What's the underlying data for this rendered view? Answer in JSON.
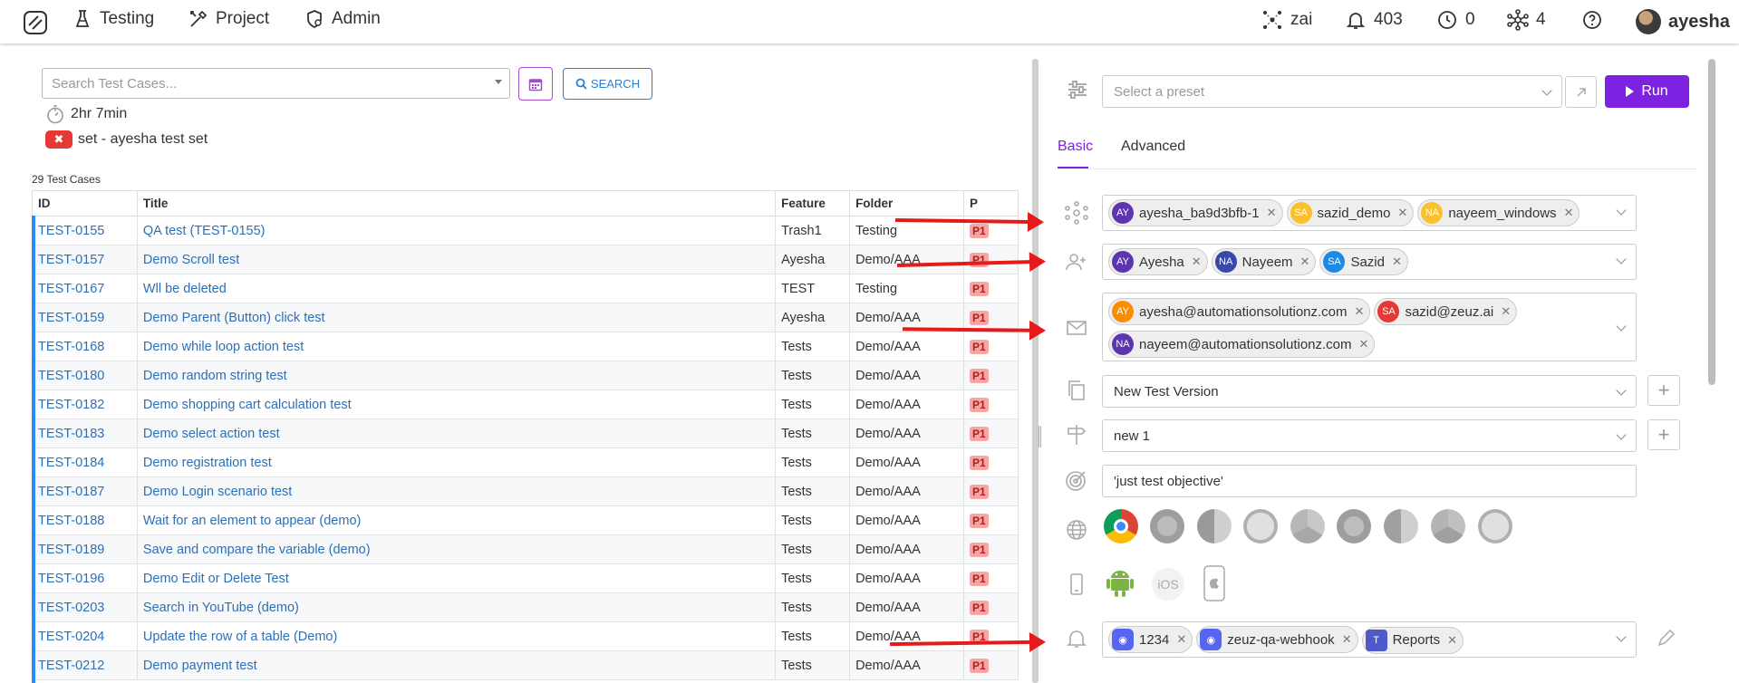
{
  "nav": {
    "items": [
      {
        "label": "Testing",
        "icon": "flask-icon"
      },
      {
        "label": "Project",
        "icon": "tools-icon"
      },
      {
        "label": "Admin",
        "icon": "admin-gear-icon"
      }
    ],
    "right": {
      "zai_label": "zai",
      "notifications": "403",
      "clock_count": "0",
      "nodes_count": "4",
      "help_icon": "help-icon",
      "username": "ayesha"
    }
  },
  "left": {
    "search_placeholder": "Search Test Cases...",
    "search_label": "SEARCH",
    "duration": "2hr 7min",
    "set_label": "set - ayesha test set",
    "count_label": "29 Test Cases",
    "columns": [
      "ID",
      "Title",
      "Feature",
      "Folder",
      "P"
    ],
    "rows": [
      {
        "id": "TEST-0155",
        "title": "QA test (TEST-0155)",
        "feature": "Trash1",
        "folder": "Testing",
        "p": "P1"
      },
      {
        "id": "TEST-0157",
        "title": "Demo Scroll test",
        "feature": "Ayesha",
        "folder": "Demo/AAA",
        "p": "P1"
      },
      {
        "id": "TEST-0167",
        "title": "Wll be deleted",
        "feature": "TEST",
        "folder": "Testing",
        "p": "P1"
      },
      {
        "id": "TEST-0159",
        "title": "Demo Parent (Button) click test",
        "feature": "Ayesha",
        "folder": "Demo/AAA",
        "p": "P1"
      },
      {
        "id": "TEST-0168",
        "title": "Demo while loop action test",
        "feature": "Tests",
        "folder": "Demo/AAA",
        "p": "P1"
      },
      {
        "id": "TEST-0180",
        "title": "Demo random string test",
        "feature": "Tests",
        "folder": "Demo/AAA",
        "p": "P1"
      },
      {
        "id": "TEST-0182",
        "title": "Demo shopping cart calculation test",
        "feature": "Tests",
        "folder": "Demo/AAA",
        "p": "P1"
      },
      {
        "id": "TEST-0183",
        "title": "Demo select action test",
        "feature": "Tests",
        "folder": "Demo/AAA",
        "p": "P1"
      },
      {
        "id": "TEST-0184",
        "title": "Demo registration test",
        "feature": "Tests",
        "folder": "Demo/AAA",
        "p": "P1"
      },
      {
        "id": "TEST-0187",
        "title": "Demo Login scenario test",
        "feature": "Tests",
        "folder": "Demo/AAA",
        "p": "P1"
      },
      {
        "id": "TEST-0188",
        "title": "Wait for an element to appear (demo)",
        "feature": "Tests",
        "folder": "Demo/AAA",
        "p": "P1"
      },
      {
        "id": "TEST-0189",
        "title": "Save and compare the variable (demo)",
        "feature": "Tests",
        "folder": "Demo/AAA",
        "p": "P1"
      },
      {
        "id": "TEST-0196",
        "title": "Demo Edit or Delete Test",
        "feature": "Tests",
        "folder": "Demo/AAA",
        "p": "P1"
      },
      {
        "id": "TEST-0203",
        "title": "Search in YouTube (demo)",
        "feature": "Tests",
        "folder": "Demo/AAA",
        "p": "P1"
      },
      {
        "id": "TEST-0204",
        "title": "Update the row of a table (Demo)",
        "feature": "Tests",
        "folder": "Demo/AAA",
        "p": "P1"
      },
      {
        "id": "TEST-0212",
        "title": "Demo payment test",
        "feature": "Tests",
        "folder": "Demo/AAA",
        "p": "P1"
      }
    ]
  },
  "right": {
    "preset_placeholder": "Select a preset",
    "run_label": "Run",
    "tabs": [
      "Basic",
      "Advanced"
    ],
    "nodes": [
      {
        "initials": "AY",
        "label": "ayesha_ba9d3bfb-1",
        "color": "#5e35b1"
      },
      {
        "initials": "SA",
        "label": "sazid_demo",
        "color": "#fbc02d"
      },
      {
        "initials": "NA",
        "label": "nayeem_windows",
        "color": "#fbc02d"
      }
    ],
    "assignees": [
      {
        "initials": "AY",
        "label": "Ayesha",
        "color": "#5e35b1"
      },
      {
        "initials": "NA",
        "label": "Nayeem",
        "color": "#3949ab"
      },
      {
        "initials": "SA",
        "label": "Sazid",
        "color": "#1e88e5"
      }
    ],
    "emails": [
      {
        "initials": "AY",
        "label": "ayesha@automationsolutionz.com",
        "color": "#fb8c00"
      },
      {
        "initials": "SA",
        "label": "sazid@zeuz.ai",
        "color": "#e53935"
      },
      {
        "initials": "NA",
        "label": "nayeem@automationsolutionz.com",
        "color": "#5e35b1"
      }
    ],
    "version": "New Test Version",
    "milestone": "new 1",
    "objective": "'just test objective'",
    "ios_label": "iOS",
    "notifications": [
      {
        "label": "1234",
        "icon": "discord-icon"
      },
      {
        "label": "zeuz-qa-webhook",
        "icon": "discord-icon"
      },
      {
        "label": "Reports",
        "icon": "teams-icon"
      }
    ]
  }
}
